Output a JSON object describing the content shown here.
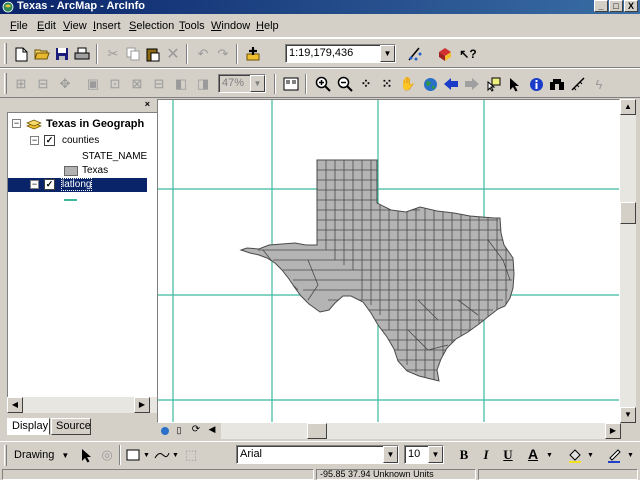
{
  "window": {
    "title": "Texas - ArcMap - ArcInfo",
    "minimize": "_",
    "maximize": "□",
    "close": "X"
  },
  "menu": [
    {
      "label": "File",
      "u": "F"
    },
    {
      "label": "Edit",
      "u": "E"
    },
    {
      "label": "View",
      "u": "V"
    },
    {
      "label": "Insert",
      "u": "I"
    },
    {
      "label": "Selection",
      "u": "S"
    },
    {
      "label": "Tools",
      "u": "T"
    },
    {
      "label": "Window",
      "u": "W"
    },
    {
      "label": "Help",
      "u": "H"
    }
  ],
  "standard_toolbar": {
    "scale": "1:19,179,436"
  },
  "layout_toolbar": {
    "zoom_percent": "47%"
  },
  "toc": {
    "data_frame": "Texas in Geograph",
    "layers": [
      {
        "name": "counties",
        "field": "STATE_NAME",
        "class_label": "Texas",
        "checked": true,
        "fill": "#b2b2b2"
      },
      {
        "name": "latlong",
        "checked": true,
        "line_color": "#3cb99e"
      }
    ],
    "tab_display": "Display",
    "tab_source": "Source"
  },
  "map": {
    "state_fill": "#b4b4b4",
    "county_line": "#4a4a4a",
    "grid_color": "#3cb99e"
  },
  "drawing_toolbar": {
    "drawing_label": "Drawing",
    "font": "Arial",
    "font_size": "10",
    "bold": "B",
    "italic": "I",
    "underline": "U",
    "font_color_letter": "A"
  },
  "status": {
    "coordinates": "-95.85  37.94 Unknown Units"
  }
}
